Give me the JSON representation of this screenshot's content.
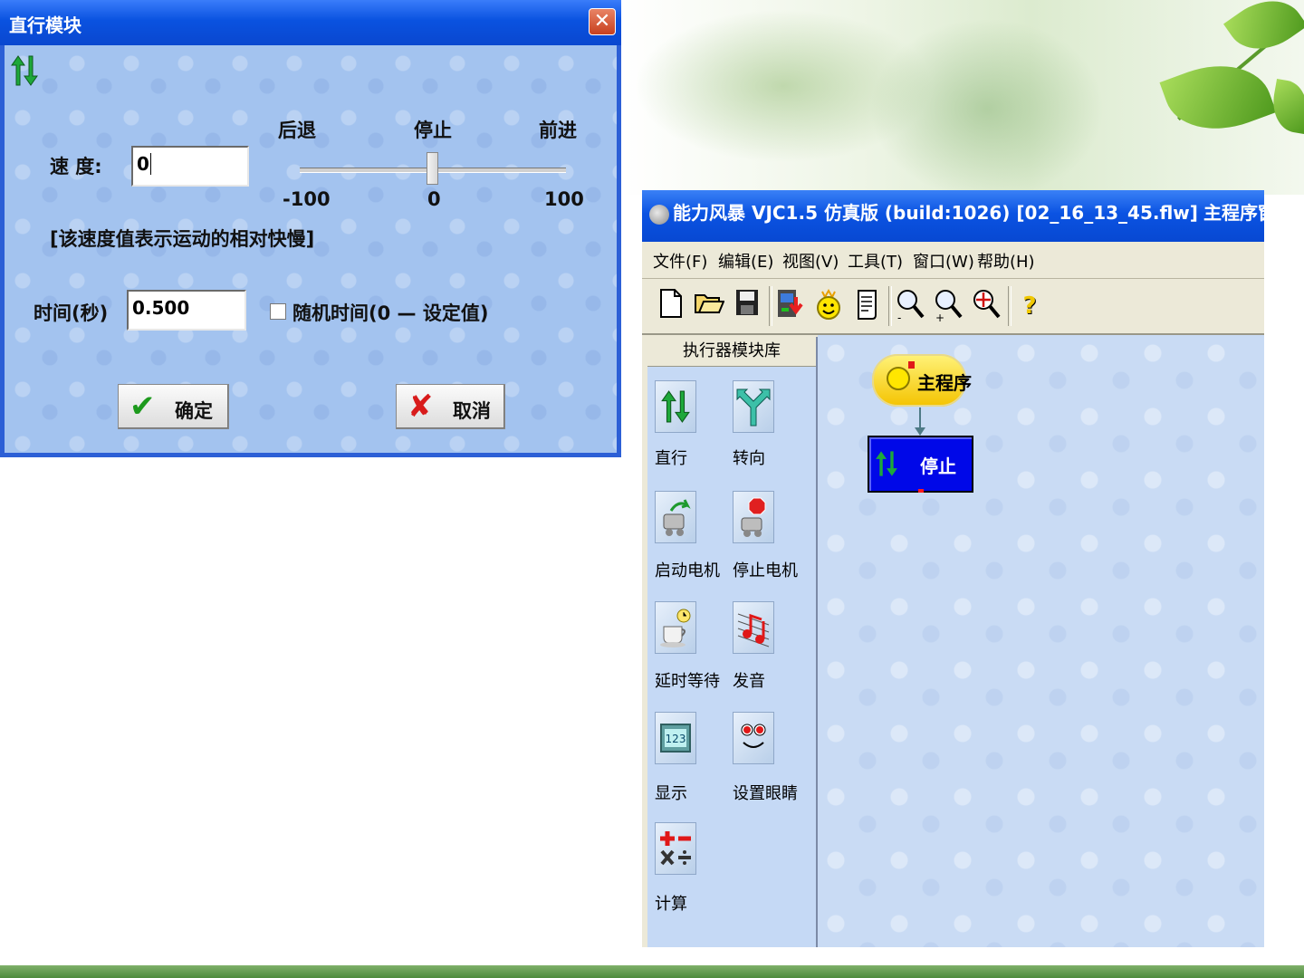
{
  "dialog": {
    "title": "直行模块",
    "close_glyph": "✕",
    "speed_label": "速 度:",
    "speed_value": "0",
    "slider": {
      "label_back": "后退",
      "label_stop": "停止",
      "label_forward": "前进",
      "min_label": "-100",
      "mid_label": "0",
      "max_label": "100",
      "value": 0,
      "min": -100,
      "max": 100
    },
    "speed_hint": "[该速度值表示运动的相对快慢]",
    "time_label": "时间(秒)",
    "time_value": "0.500",
    "random_checkbox_label": "随机时间(0 — 设定值)",
    "random_checked": false,
    "ok_label": "确定",
    "cancel_label": "取消",
    "header_icon": "up-down-arrows-icon"
  },
  "app": {
    "title": "能力风暴 VJC1.5 仿真版 (build:1026) [02_16_13_45.flw]",
    "title_right": "主程序窗",
    "menu": [
      "文件(F)",
      "编辑(E)",
      "视图(V)",
      "工具(T)",
      "窗口(W)",
      "帮助(H)"
    ],
    "toolbar_icons": [
      "new-file-icon",
      "open-folder-icon",
      "save-icon",
      "download-icon",
      "robot-smiley-icon",
      "script-icon",
      "zoom-out-icon",
      "zoom-in-icon",
      "zoom-fit-icon",
      "help-icon"
    ],
    "palette": {
      "header": "执行器模块库",
      "items": [
        "直行",
        "转向",
        "启动电机",
        "停止电机",
        "延时等待",
        "发音",
        "显示",
        "设置眼睛",
        "计算"
      ]
    },
    "canvas": {
      "main_node_label": "主程序",
      "stop_node_label": "停止"
    }
  },
  "colors": {
    "title_blue": "#0a52e0",
    "dialog_body": "#a3c3ef",
    "canvas_bg": "#c9dbf4",
    "stop_node": "#0008e8",
    "main_node": "#f4c300"
  }
}
